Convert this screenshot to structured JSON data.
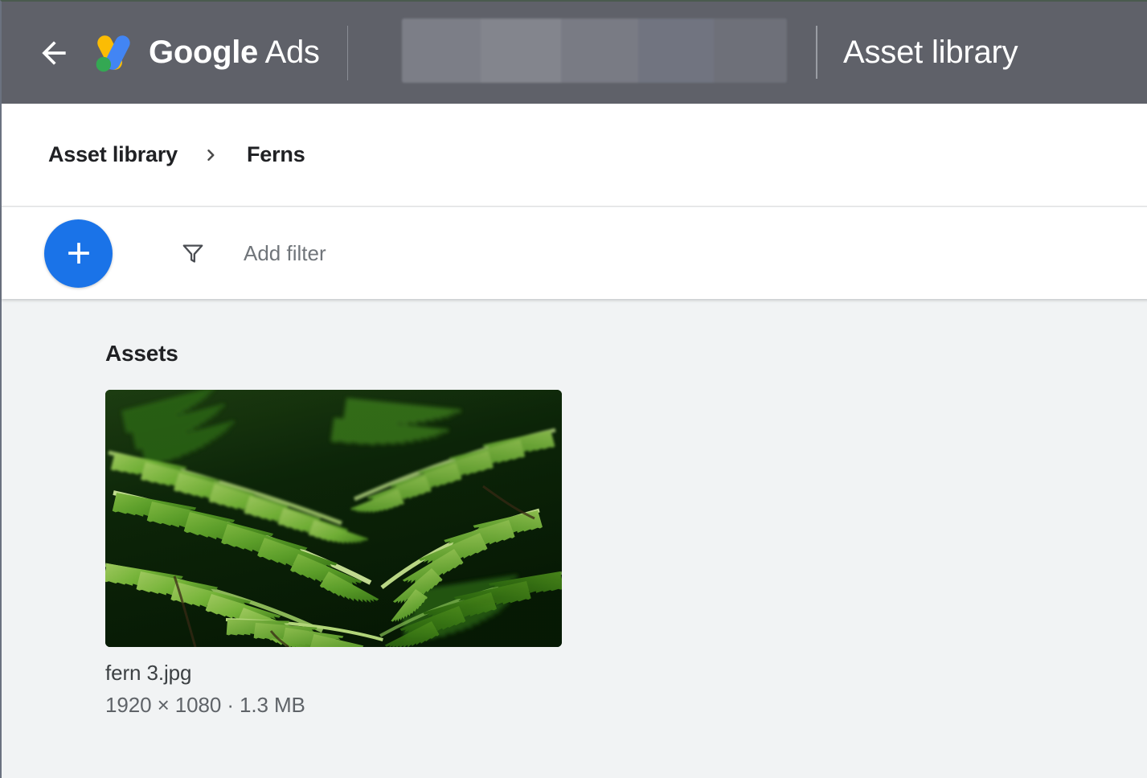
{
  "appbar": {
    "back_icon": "arrow-back-icon",
    "logo_icon": "google-ads-logo-icon",
    "brand_bold": "Google",
    "brand_light": "Ads",
    "account_redacted": "",
    "title": "Asset library"
  },
  "breadcrumb": {
    "root": "Asset library",
    "separator_icon": "chevron-right-icon",
    "current": "Ferns"
  },
  "toolbar": {
    "add_label": "+",
    "add_icon": "plus-icon",
    "filter_icon": "funnel-icon",
    "filter_placeholder": "Add filter",
    "filter_value": ""
  },
  "main": {
    "section_title": "Assets",
    "assets": [
      {
        "name": "fern 3.jpg",
        "meta": "1920 × 1080 · 1.3 MB",
        "dimensions": "1920 × 1080",
        "size": "1.3 MB",
        "thumbnail_alt": "fern-fronds-photo"
      }
    ]
  },
  "colors": {
    "appbar_bg": "#5f6169",
    "accent_blue": "#1a73e8",
    "content_bg": "#f1f3f4",
    "text_primary": "#202124",
    "text_secondary": "#5f6368",
    "logo_blue": "#4285f4",
    "logo_yellow": "#fbbc04",
    "logo_green": "#34a853"
  }
}
